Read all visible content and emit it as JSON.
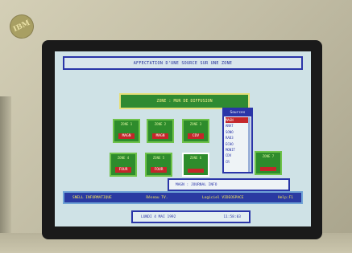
{
  "bezel": {
    "logo": "IBM"
  },
  "app": {
    "title": "AFFECTATION D'UNE SOURCE SUR UNE ZONE",
    "map_title": "ZONE : MUR DE DIFFUSION"
  },
  "zones": [
    {
      "label": "ZONE 1",
      "source": "MAGN"
    },
    {
      "label": "ZONE 2",
      "source": "MAGN"
    },
    {
      "label": "ZONE 3",
      "source": "CDV"
    },
    {
      "label": "ZONE 4",
      "source": "FOUR"
    },
    {
      "label": "ZONE 5",
      "source": "FOUR"
    },
    {
      "label": "ZONE 6",
      "source": ""
    },
    {
      "label": "ZONE 7",
      "source": ""
    }
  ],
  "sources": {
    "title": "Sources",
    "items": [
      "MAGN",
      "ANAT",
      "SONO",
      "RAD3",
      "ECHO",
      "MONIT",
      "CDV",
      "CR"
    ],
    "selected_index": 0
  },
  "info": {
    "text": "MAGN : JOURNAL INFO"
  },
  "status": {
    "company": "SNELL INFORMATIQUE",
    "sub": "Réseau TV.",
    "software": "Logiciel VIDEOSPACE",
    "help": "Help:F1"
  },
  "datebar": {
    "date": "LUNDI 4 MAI 1992",
    "time": "11:58:03"
  }
}
